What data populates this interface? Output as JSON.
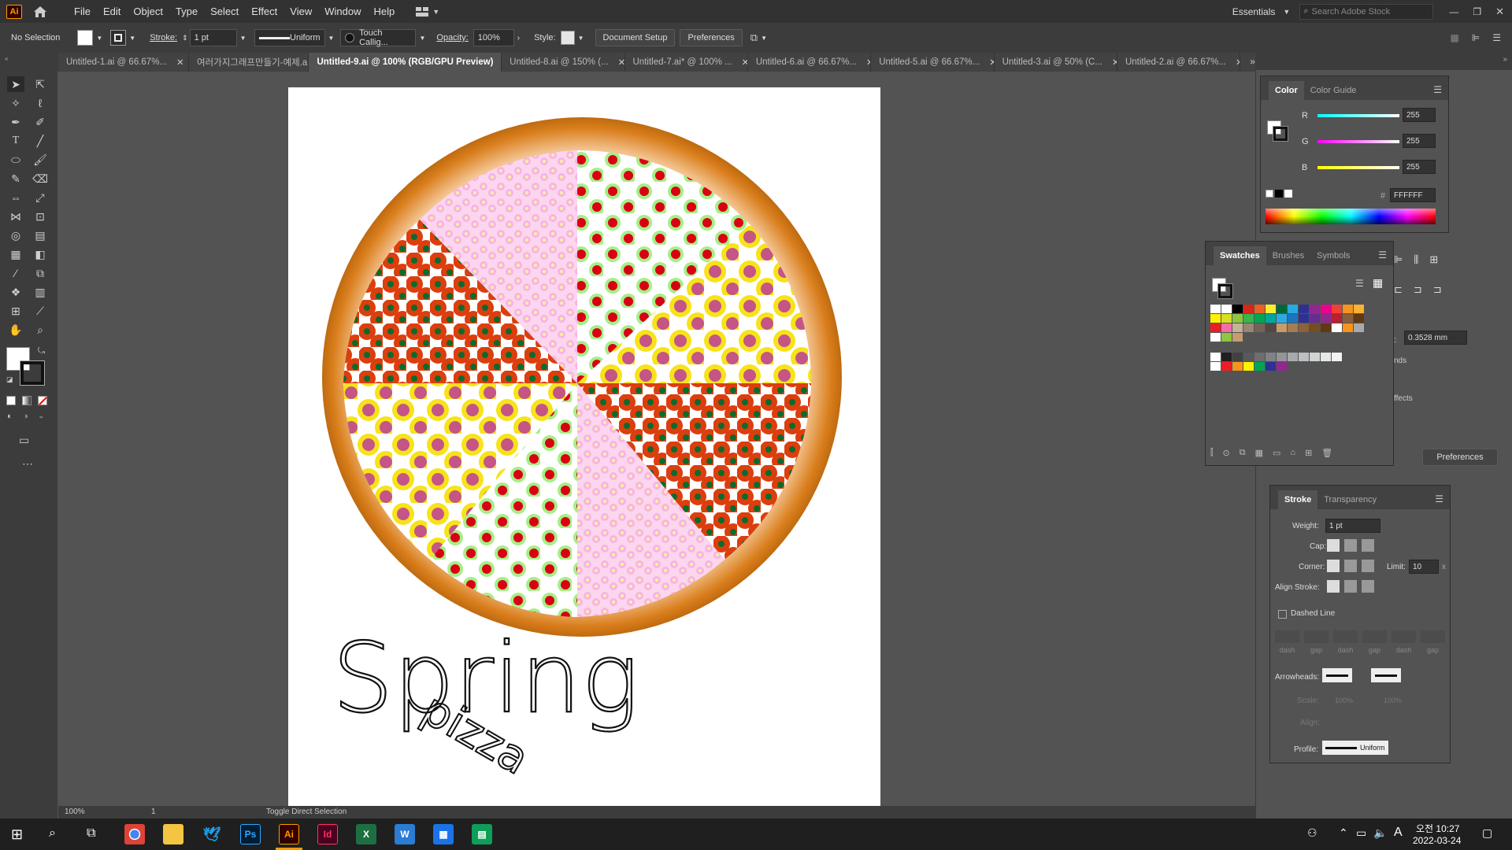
{
  "menubar": {
    "app_logo": "Ai",
    "items": [
      "File",
      "Edit",
      "Object",
      "Type",
      "Select",
      "Effect",
      "View",
      "Window",
      "Help"
    ],
    "workspace": "Essentials",
    "search_placeholder": "Search Adobe Stock"
  },
  "controlbar": {
    "selection": "No Selection",
    "stroke_label": "Stroke:",
    "stroke_value": "1 pt",
    "stroke_profile": "Uniform",
    "brush": "Touch Callig...",
    "opacity_label": "Opacity:",
    "opacity_value": "100%",
    "style_label": "Style:",
    "document_setup": "Document Setup",
    "preferences": "Preferences"
  },
  "tabs": [
    {
      "label": "Untitled-1.ai @ 66.67%..."
    },
    {
      "label": "여러가지그래프만들기-예제.ai*"
    },
    {
      "label": "Untitled-9.ai @ 100% (RGB/GPU Preview)",
      "active": true
    },
    {
      "label": "Untitled-8.ai @ 150% (..."
    },
    {
      "label": "Untitled-7.ai* @ 100% ..."
    },
    {
      "label": "Untitled-6.ai @ 66.67%..."
    },
    {
      "label": "Untitled-5.ai @ 66.67%..."
    },
    {
      "label": "Untitled-3.ai @ 50% (C..."
    },
    {
      "label": "Untitled-2.ai @ 66.67%..."
    }
  ],
  "artwork": {
    "title_word": "Spring",
    "sub_word": "pizza"
  },
  "color_panel": {
    "tabs": [
      "Color",
      "Color Guide"
    ],
    "r_label": "R",
    "r_value": "255",
    "g_label": "G",
    "g_value": "255",
    "b_label": "B",
    "b_value": "255",
    "hash": "#",
    "hex": "FFFFFF"
  },
  "swatches_panel": {
    "tabs": [
      "Swatches",
      "Brushes",
      "Symbols"
    ]
  },
  "stroke_panel": {
    "tabs": [
      "Stroke",
      "Transparency"
    ],
    "weight_label": "Weight:",
    "weight_value": "1 pt",
    "cap_label": "Cap:",
    "corner_label": "Corner:",
    "limit_label": "Limit:",
    "limit_value": "10",
    "limit_unit": "x",
    "align_label": "Align Stroke:",
    "dashed_label": "Dashed Line",
    "dash_labels": [
      "dash",
      "gap",
      "dash",
      "gap",
      "dash",
      "gap"
    ],
    "arrowheads_label": "Arrowheads:",
    "scale_label": "Scale:",
    "scale_value_1": "100%",
    "scale_value_2": "100%",
    "align_arrow_label": "Align:",
    "profile_label": "Profile:",
    "profile_value": "Uniform"
  },
  "properties_hidden": {
    "measure_suffix": "t:",
    "measure_value": "0.3528 mm",
    "text_ends": "nds",
    "text_effects": "ffects",
    "preferences": "Preferences"
  },
  "statusbar": {
    "zoom": "100%",
    "artboard_num": "1",
    "tool_hint": "Toggle Direct Selection"
  },
  "taskbar": {
    "time": "오전 10:27",
    "date": "2022-03-24",
    "ime": "A",
    "apps": [
      "Chrome",
      "File Explorer",
      "Twitter",
      "Photoshop",
      "Illustrator",
      "InDesign",
      "Excel",
      "Dictionary",
      "Calculator",
      "Sheets"
    ]
  }
}
